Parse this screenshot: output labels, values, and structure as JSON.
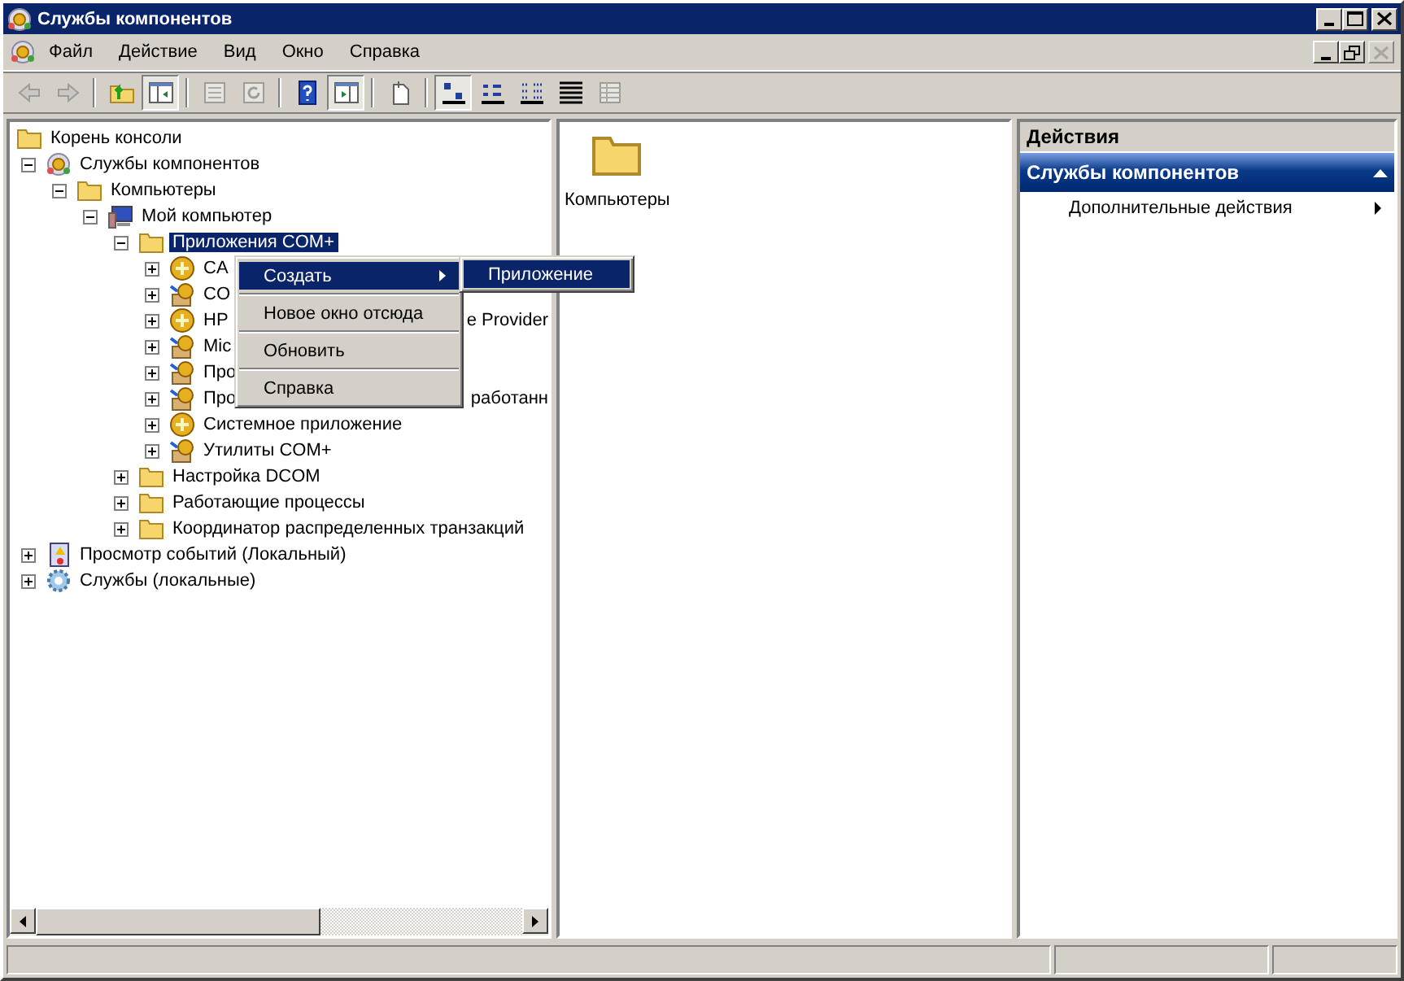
{
  "window": {
    "title": "Службы компонентов"
  },
  "menu_bar": [
    "Файл",
    "Действие",
    "Вид",
    "Окно",
    "Справка"
  ],
  "toolbar": [
    {
      "kind": "back",
      "pressed": false,
      "disabled": true
    },
    {
      "kind": "forward",
      "pressed": false,
      "disabled": true
    },
    {
      "kind": "separator"
    },
    {
      "kind": "up",
      "pressed": false,
      "disabled": false
    },
    {
      "kind": "console-tree",
      "pressed": true,
      "disabled": false
    },
    {
      "kind": "separator"
    },
    {
      "kind": "properties",
      "pressed": false,
      "disabled": true
    },
    {
      "kind": "refresh",
      "pressed": false,
      "disabled": true
    },
    {
      "kind": "separator"
    },
    {
      "kind": "help",
      "pressed": false,
      "disabled": false
    },
    {
      "kind": "action-pane",
      "pressed": true,
      "disabled": false
    },
    {
      "kind": "separator"
    },
    {
      "kind": "new-window",
      "pressed": false,
      "disabled": false
    },
    {
      "kind": "separator"
    },
    {
      "kind": "large-icons",
      "pressed": true,
      "disabled": false
    },
    {
      "kind": "small-icons",
      "pressed": false,
      "disabled": false
    },
    {
      "kind": "list",
      "pressed": false,
      "disabled": false
    },
    {
      "kind": "details",
      "pressed": false,
      "disabled": false
    },
    {
      "kind": "grid",
      "pressed": false,
      "disabled": true
    }
  ],
  "tree": [
    {
      "label": "Корень консоли",
      "kind": "folder",
      "selected": false,
      "children": [
        {
          "label": "Службы компонентов",
          "kind": "component-services",
          "expanded": true,
          "selected": false,
          "children": [
            {
              "label": "Компьютеры",
              "kind": "folder",
              "expanded": true,
              "selected": false,
              "children": [
                {
                  "label": "Мой компьютер",
                  "kind": "computer",
                  "expanded": true,
                  "selected": false,
                  "children": [
                    {
                      "label": "Приложения COM+",
                      "kind": "folder",
                      "expanded": true,
                      "selected": true,
                      "children": [
                        {
                          "label": "CA",
                          "kind": "com-ball",
                          "expanded": false,
                          "selected": false
                        },
                        {
                          "label": "CO",
                          "kind": "com-box",
                          "expanded": false,
                          "selected": false
                        },
                        {
                          "label": "HP",
                          "tail": "e Provider",
                          "kind": "com-ball",
                          "expanded": false,
                          "selected": false
                        },
                        {
                          "label": "Mic",
                          "kind": "com-box",
                          "expanded": false,
                          "selected": false
                        },
                        {
                          "label": "Про",
                          "kind": "com-box",
                          "expanded": false,
                          "selected": false
                        },
                        {
                          "label": "Про",
                          "tail": "работанн",
                          "kind": "com-box",
                          "expanded": false,
                          "selected": false
                        },
                        {
                          "label": "Системное приложение",
                          "kind": "com-ball",
                          "expanded": false,
                          "selected": false
                        },
                        {
                          "label": "Утилиты COM+",
                          "kind": "com-box",
                          "expanded": false,
                          "selected": false
                        }
                      ]
                    },
                    {
                      "label": "Настройка DCOM",
                      "kind": "folder",
                      "expanded": false,
                      "selected": false
                    },
                    {
                      "label": "Работающие процессы",
                      "kind": "folder",
                      "expanded": false,
                      "selected": false
                    },
                    {
                      "label": "Координатор распределенных транзакций",
                      "kind": "folder",
                      "expanded": false,
                      "selected": false
                    }
                  ]
                }
              ]
            }
          ]
        },
        {
          "label": "Просмотр событий (Локальный)",
          "kind": "event-viewer",
          "expanded": false,
          "selected": false
        },
        {
          "label": "Службы (локальные)",
          "kind": "services",
          "expanded": false,
          "selected": false
        }
      ]
    }
  ],
  "context_menu": [
    {
      "label": "Создать",
      "submenu": true,
      "selected": true
    },
    {
      "label": "Новое окно отсюда",
      "submenu": false,
      "selected": false
    },
    {
      "label": "Обновить",
      "submenu": false,
      "selected": false
    },
    {
      "label": "Справка",
      "submenu": false,
      "selected": false
    }
  ],
  "submenu": [
    {
      "label": "Приложение",
      "selected": true
    }
  ],
  "content": [
    {
      "label": "Компьютеры",
      "kind": "folder"
    }
  ],
  "actions": {
    "title": "Действия",
    "section": "Службы компонентов",
    "items": [
      "Дополнительные действия"
    ]
  }
}
